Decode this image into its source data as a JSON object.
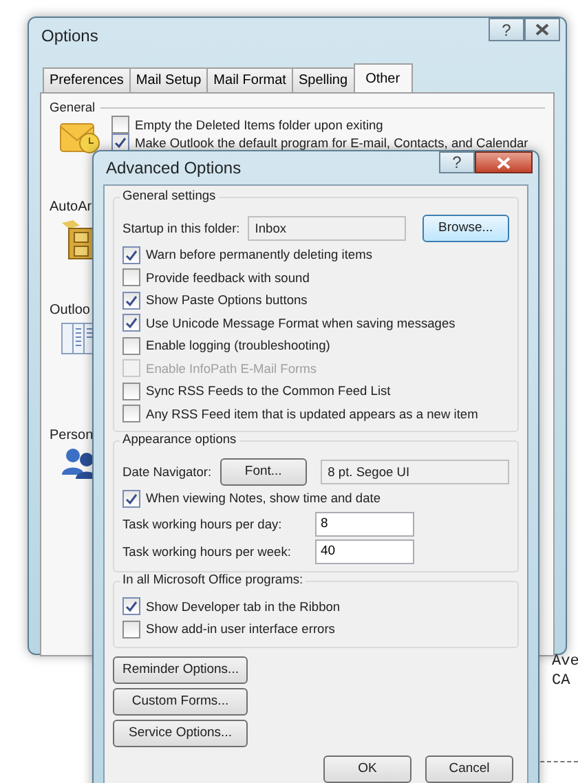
{
  "background": {
    "labels": [
      "Ave",
      "CA"
    ]
  },
  "options_window": {
    "title": "Options",
    "help": "?",
    "tabs": [
      {
        "label": "Preferences",
        "selected": false
      },
      {
        "label": "Mail Setup",
        "selected": false
      },
      {
        "label": "Mail Format",
        "selected": false
      },
      {
        "label": "Spelling",
        "selected": false
      },
      {
        "label": "Other",
        "selected": true
      }
    ],
    "general": {
      "heading": "General",
      "checkboxes": [
        {
          "label": "Empty the Deleted Items folder upon exiting",
          "checked": false
        },
        {
          "label": "Make Outlook the default program for E-mail, Contacts, and Calendar",
          "checked": true
        }
      ]
    },
    "sections": [
      {
        "label": "AutoAr",
        "kind": "archive"
      },
      {
        "label": "Outloo",
        "kind": "panes"
      },
      {
        "label": "Person",
        "kind": "people"
      }
    ]
  },
  "advanced_options": {
    "title": "Advanced Options",
    "help": "?",
    "general_settings": {
      "heading": "General settings",
      "startup_label": "Startup in this folder:",
      "startup_value": "Inbox",
      "browse_button": "Browse...",
      "checkboxes": [
        {
          "label": "Warn before permanently deleting items",
          "checked": true,
          "disabled": false
        },
        {
          "label": "Provide feedback with sound",
          "checked": false,
          "disabled": false
        },
        {
          "label": "Show Paste Options buttons",
          "checked": true,
          "disabled": false
        },
        {
          "label": "Use Unicode Message Format when saving messages",
          "checked": true,
          "disabled": false
        },
        {
          "label": "Enable logging (troubleshooting)",
          "checked": false,
          "disabled": false
        },
        {
          "label": "Enable InfoPath E-Mail Forms",
          "checked": false,
          "disabled": true
        },
        {
          "label": "Sync RSS Feeds to the Common Feed List",
          "checked": false,
          "disabled": false
        },
        {
          "label": "Any RSS Feed item that is updated appears as a new item",
          "checked": false,
          "disabled": false
        }
      ]
    },
    "appearance": {
      "heading": "Appearance options",
      "date_navigator_label": "Date Navigator:",
      "font_button": "Font...",
      "font_value": "8 pt. Segoe UI",
      "notes_checkbox": {
        "label": "When viewing Notes, show time and date",
        "checked": true
      },
      "fields": [
        {
          "label": "Task working hours per day:",
          "value": "8"
        },
        {
          "label": "Task working hours per week:",
          "value": "40"
        }
      ]
    },
    "office": {
      "heading": "In all Microsoft Office programs:",
      "checkboxes": [
        {
          "label": "Show Developer tab in the Ribbon",
          "checked": true
        },
        {
          "label": "Show add-in user interface errors",
          "checked": false
        }
      ]
    },
    "buttons": [
      "Reminder Options...",
      "Custom Forms...",
      "Service Options..."
    ],
    "ok": "OK",
    "cancel": "Cancel"
  }
}
